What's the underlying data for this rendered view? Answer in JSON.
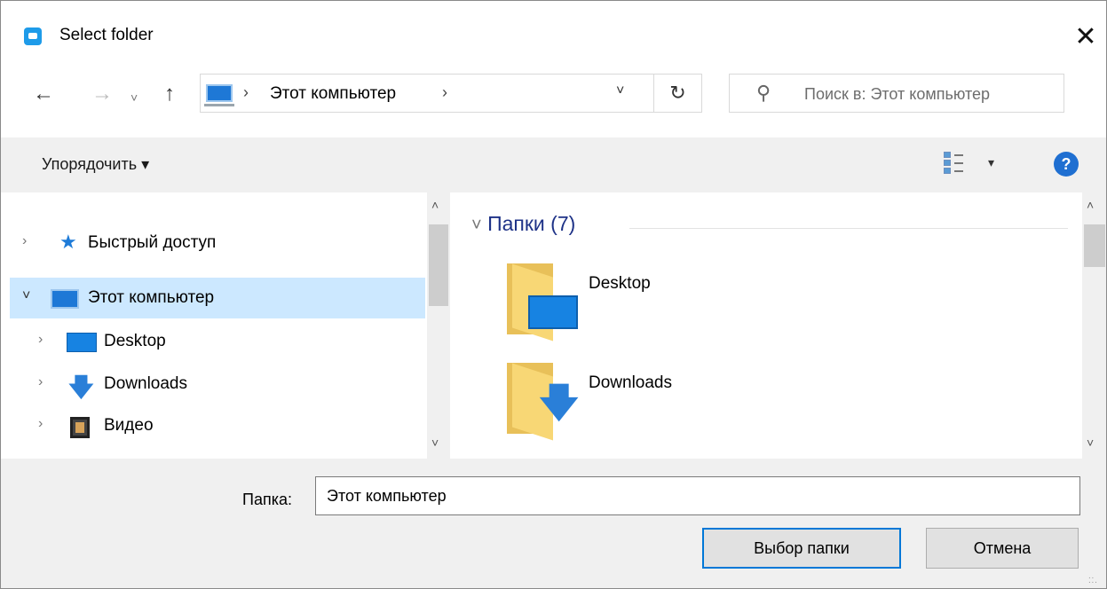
{
  "window": {
    "title": "Select folder",
    "close_glyph": "✕"
  },
  "nav": {
    "back_glyph": "←",
    "forward_glyph": "→",
    "recent_glyph": "˅",
    "up_glyph": "↑",
    "address": {
      "location": "Этот компьютер",
      "separator": "›",
      "dropdown_glyph": "˅"
    },
    "refresh_glyph": "↻",
    "search": {
      "icon_glyph": "⚲",
      "placeholder": "Поиск в: Этот компьютер"
    }
  },
  "toolbar": {
    "organize_label": "Упорядочить ▾",
    "view_dropdown_glyph": "▾",
    "help_label": "?"
  },
  "tree": {
    "items": [
      {
        "label": "Быстрый доступ",
        "chevron": "›"
      },
      {
        "label": "Этот компьютер",
        "chevron": "˅",
        "selected": true
      },
      {
        "label": "Desktop",
        "chevron": "›"
      },
      {
        "label": "Downloads",
        "chevron": "›"
      },
      {
        "label": "Видео",
        "chevron": "›"
      }
    ],
    "scroll_up": "˄",
    "scroll_down": "˅"
  },
  "content": {
    "group_header": "Папки (7)",
    "group_chevron": "˅",
    "folders": [
      {
        "name": "Desktop"
      },
      {
        "name": "Downloads"
      }
    ],
    "scroll_up": "˄",
    "scroll_down": "˅"
  },
  "footer": {
    "folder_label": "Папка:",
    "folder_value": "Этот компьютер",
    "ok_button": "Выбор папки",
    "cancel_button": "Отмена"
  },
  "colors": {
    "selection": "#cce8ff",
    "group_header": "#1e3287",
    "accent": "#0078d7"
  }
}
